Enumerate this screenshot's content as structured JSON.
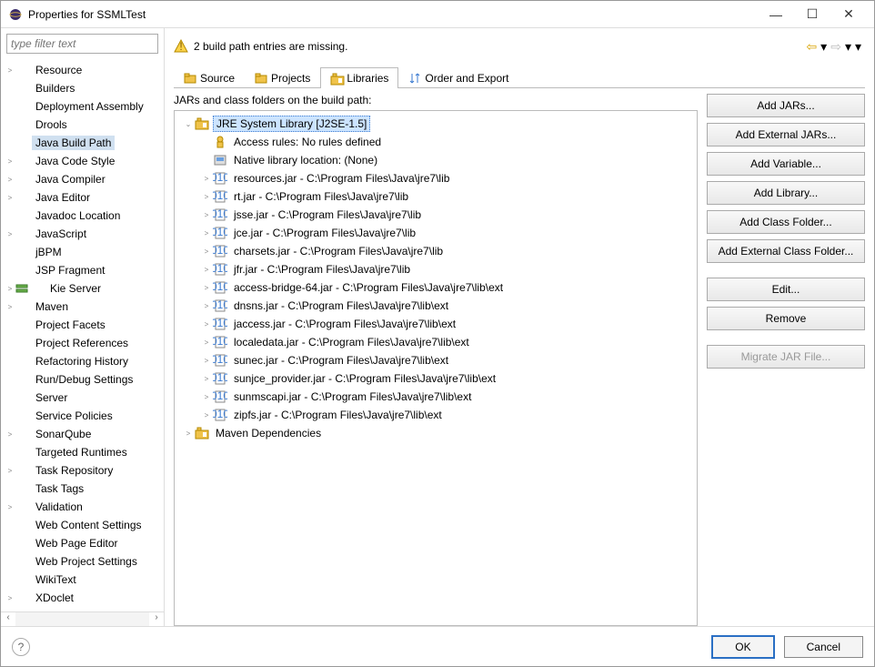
{
  "window": {
    "title": "Properties for SSMLTest"
  },
  "filter_placeholder": "type filter text",
  "left_tree": [
    {
      "lvl": 0,
      "exp": ">",
      "label": "Resource"
    },
    {
      "lvl": 0,
      "exp": "",
      "label": "Builders"
    },
    {
      "lvl": 0,
      "exp": "",
      "label": "Deployment Assembly"
    },
    {
      "lvl": 0,
      "exp": "",
      "label": "Drools"
    },
    {
      "lvl": 0,
      "exp": "",
      "label": "Java Build Path",
      "sel": true
    },
    {
      "lvl": 0,
      "exp": ">",
      "label": "Java Code Style"
    },
    {
      "lvl": 0,
      "exp": ">",
      "label": "Java Compiler"
    },
    {
      "lvl": 0,
      "exp": ">",
      "label": "Java Editor"
    },
    {
      "lvl": 0,
      "exp": "",
      "label": "Javadoc Location"
    },
    {
      "lvl": 0,
      "exp": ">",
      "label": "JavaScript"
    },
    {
      "lvl": 0,
      "exp": "",
      "label": "jBPM"
    },
    {
      "lvl": 0,
      "exp": "",
      "label": "JSP Fragment"
    },
    {
      "lvl": 0,
      "exp": ">",
      "label": "Kie Server",
      "icon": "server"
    },
    {
      "lvl": 0,
      "exp": ">",
      "label": "Maven"
    },
    {
      "lvl": 0,
      "exp": "",
      "label": "Project Facets"
    },
    {
      "lvl": 0,
      "exp": "",
      "label": "Project References"
    },
    {
      "lvl": 0,
      "exp": "",
      "label": "Refactoring History"
    },
    {
      "lvl": 0,
      "exp": "",
      "label": "Run/Debug Settings"
    },
    {
      "lvl": 0,
      "exp": "",
      "label": "Server"
    },
    {
      "lvl": 0,
      "exp": "",
      "label": "Service Policies"
    },
    {
      "lvl": 0,
      "exp": ">",
      "label": "SonarQube"
    },
    {
      "lvl": 0,
      "exp": "",
      "label": "Targeted Runtimes"
    },
    {
      "lvl": 0,
      "exp": ">",
      "label": "Task Repository"
    },
    {
      "lvl": 0,
      "exp": "",
      "label": "Task Tags"
    },
    {
      "lvl": 0,
      "exp": ">",
      "label": "Validation"
    },
    {
      "lvl": 0,
      "exp": "",
      "label": "Web Content Settings"
    },
    {
      "lvl": 0,
      "exp": "",
      "label": "Web Page Editor"
    },
    {
      "lvl": 0,
      "exp": "",
      "label": "Web Project Settings"
    },
    {
      "lvl": 0,
      "exp": "",
      "label": "WikiText"
    },
    {
      "lvl": 0,
      "exp": ">",
      "label": "XDoclet"
    }
  ],
  "banner_msg": "2 build path entries are missing.",
  "tabs": [
    {
      "label": "Source",
      "icon": "folder"
    },
    {
      "label": "Projects",
      "icon": "folder"
    },
    {
      "label": "Libraries",
      "icon": "lib",
      "active": true
    },
    {
      "label": "Order and Export",
      "icon": "order"
    }
  ],
  "tree_hint": "JARs and class folders on the build path:",
  "libs": [
    {
      "lvl": 0,
      "exp": "v",
      "icon": "lib",
      "label": "JRE System Library [J2SE-1.5]",
      "sel": true
    },
    {
      "lvl": 1,
      "exp": "",
      "icon": "access",
      "label": "Access rules: No rules defined"
    },
    {
      "lvl": 1,
      "exp": "",
      "icon": "native",
      "label": "Native library location: (None)"
    },
    {
      "lvl": 1,
      "exp": ">",
      "icon": "jar",
      "label": "resources.jar - C:\\Program Files\\Java\\jre7\\lib"
    },
    {
      "lvl": 1,
      "exp": ">",
      "icon": "jar",
      "label": "rt.jar - C:\\Program Files\\Java\\jre7\\lib"
    },
    {
      "lvl": 1,
      "exp": ">",
      "icon": "jar",
      "label": "jsse.jar - C:\\Program Files\\Java\\jre7\\lib"
    },
    {
      "lvl": 1,
      "exp": ">",
      "icon": "jar",
      "label": "jce.jar - C:\\Program Files\\Java\\jre7\\lib"
    },
    {
      "lvl": 1,
      "exp": ">",
      "icon": "jar",
      "label": "charsets.jar - C:\\Program Files\\Java\\jre7\\lib"
    },
    {
      "lvl": 1,
      "exp": ">",
      "icon": "jar",
      "label": "jfr.jar - C:\\Program Files\\Java\\jre7\\lib"
    },
    {
      "lvl": 1,
      "exp": ">",
      "icon": "jar",
      "label": "access-bridge-64.jar - C:\\Program Files\\Java\\jre7\\lib\\ext"
    },
    {
      "lvl": 1,
      "exp": ">",
      "icon": "jar",
      "label": "dnsns.jar - C:\\Program Files\\Java\\jre7\\lib\\ext"
    },
    {
      "lvl": 1,
      "exp": ">",
      "icon": "jar",
      "label": "jaccess.jar - C:\\Program Files\\Java\\jre7\\lib\\ext"
    },
    {
      "lvl": 1,
      "exp": ">",
      "icon": "jar",
      "label": "localedata.jar - C:\\Program Files\\Java\\jre7\\lib\\ext"
    },
    {
      "lvl": 1,
      "exp": ">",
      "icon": "jar",
      "label": "sunec.jar - C:\\Program Files\\Java\\jre7\\lib\\ext"
    },
    {
      "lvl": 1,
      "exp": ">",
      "icon": "jar",
      "label": "sunjce_provider.jar - C:\\Program Files\\Java\\jre7\\lib\\ext"
    },
    {
      "lvl": 1,
      "exp": ">",
      "icon": "jar",
      "label": "sunmscapi.jar - C:\\Program Files\\Java\\jre7\\lib\\ext"
    },
    {
      "lvl": 1,
      "exp": ">",
      "icon": "jar",
      "label": "zipfs.jar - C:\\Program Files\\Java\\jre7\\lib\\ext"
    },
    {
      "lvl": 0,
      "exp": ">",
      "icon": "lib",
      "label": "Maven Dependencies"
    }
  ],
  "buttons": {
    "add_jars": "Add JARs...",
    "add_ext_jars": "Add External JARs...",
    "add_var": "Add Variable...",
    "add_lib": "Add Library...",
    "add_class": "Add Class Folder...",
    "add_ext_class": "Add External Class Folder...",
    "edit": "Edit...",
    "remove": "Remove",
    "migrate": "Migrate JAR File..."
  },
  "bottom": {
    "ok": "OK",
    "cancel": "Cancel"
  }
}
